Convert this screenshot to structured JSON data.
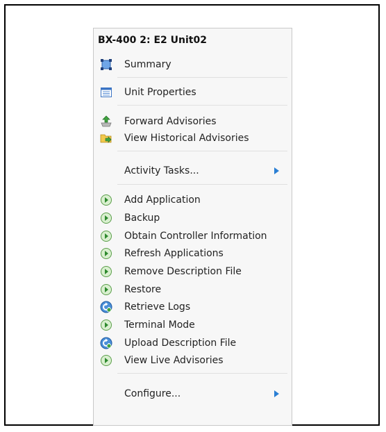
{
  "menu": {
    "title": "BX-400 2: E2 Unit02",
    "items": [
      {
        "label": "Summary",
        "icon": "summary-icon"
      },
      {
        "label": "Unit Properties",
        "icon": "properties-icon"
      },
      {
        "label": "Forward Advisories",
        "icon": "forward-advisories-icon"
      },
      {
        "label": "View Historical Advisories",
        "icon": "historical-advisories-icon"
      },
      {
        "label": "Activity Tasks...",
        "icon": "submenu-arrow-icon"
      },
      {
        "label": "Add Application",
        "icon": "play-circle-icon"
      },
      {
        "label": "Backup",
        "icon": "play-circle-icon"
      },
      {
        "label": "Obtain Controller Information",
        "icon": "play-circle-icon"
      },
      {
        "label": "Refresh Applications",
        "icon": "play-circle-icon"
      },
      {
        "label": "Remove Description File",
        "icon": "play-circle-icon"
      },
      {
        "label": "Restore",
        "icon": "play-circle-icon"
      },
      {
        "label": "Retrieve Logs",
        "icon": "refresh-cycle-icon"
      },
      {
        "label": "Terminal Mode",
        "icon": "play-circle-icon"
      },
      {
        "label": "Upload Description File",
        "icon": "refresh-cycle-icon"
      },
      {
        "label": "View Live Advisories",
        "icon": "play-circle-icon"
      },
      {
        "label": "Configure...",
        "icon": "submenu-arrow-icon"
      }
    ]
  }
}
